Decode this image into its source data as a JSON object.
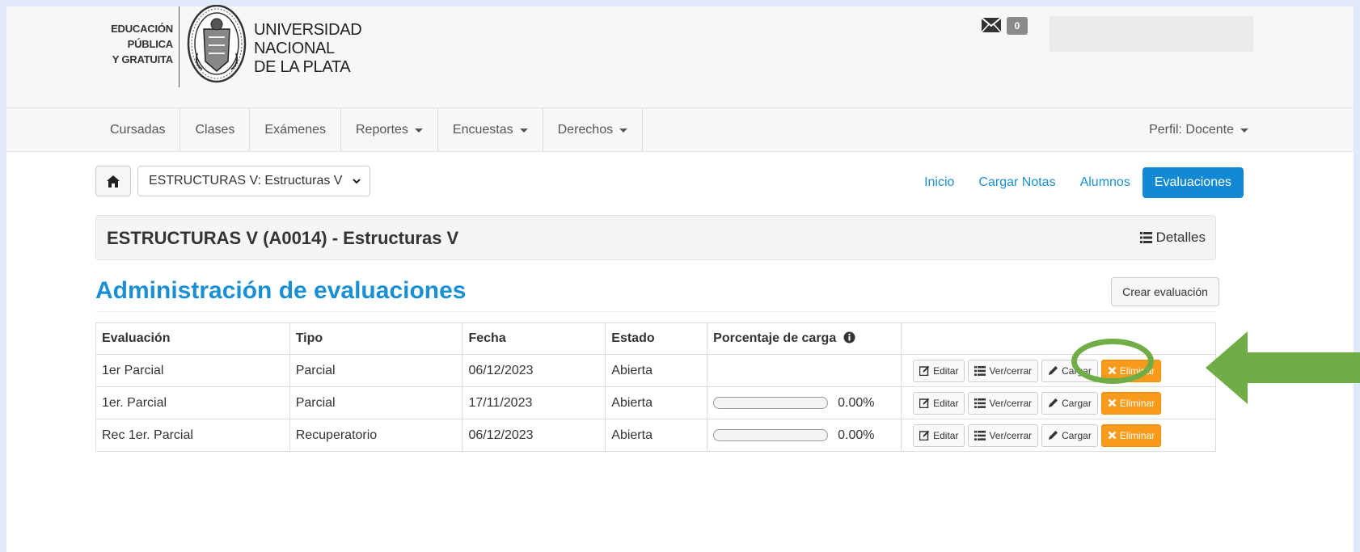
{
  "header": {
    "edu_lines": [
      "EDUCACIÓN",
      "PÚBLICA",
      "Y GRATUITA"
    ],
    "university_lines": [
      "UNIVERSIDAD",
      "NACIONAL",
      "DE LA PLATA"
    ],
    "message_count": "0"
  },
  "nav": {
    "items": [
      {
        "label": "Cursadas",
        "dropdown": false
      },
      {
        "label": "Clases",
        "dropdown": false
      },
      {
        "label": "Exámenes",
        "dropdown": false
      },
      {
        "label": "Reportes",
        "dropdown": true
      },
      {
        "label": "Encuestas",
        "dropdown": true
      },
      {
        "label": "Derechos",
        "dropdown": true
      }
    ],
    "profile": "Perfil: Docente"
  },
  "toolbar": {
    "course_select": "ESTRUCTURAS V: Estructuras V",
    "tabs": [
      {
        "label": "Inicio",
        "active": false
      },
      {
        "label": "Cargar Notas",
        "active": false
      },
      {
        "label": "Alumnos",
        "active": false
      },
      {
        "label": "Evaluaciones",
        "active": true
      }
    ]
  },
  "course": {
    "title": "ESTRUCTURAS V (A0014) - Estructuras V",
    "details_label": "Detalles"
  },
  "page": {
    "title": "Administración de evaluaciones",
    "create_button": "Crear evaluación"
  },
  "table": {
    "headers": [
      "Evaluación",
      "Tipo",
      "Fecha",
      "Estado",
      "Porcentaje de carga"
    ],
    "rows": [
      {
        "evaluacion": "1er Parcial",
        "tipo": "Parcial",
        "fecha": "06/12/2023",
        "estado": "Abierta",
        "percent": null,
        "percent_label": ""
      },
      {
        "evaluacion": "1er. Parcial",
        "tipo": "Parcial",
        "fecha": "17/11/2023",
        "estado": "Abierta",
        "percent": 0,
        "percent_label": "0.00%"
      },
      {
        "evaluacion": "Rec 1er. Parcial",
        "tipo": "Recuperatorio",
        "fecha": "06/12/2023",
        "estado": "Abierta",
        "percent": 0,
        "percent_label": "0.00%"
      }
    ],
    "actions": {
      "edit": "Editar",
      "view": "Ver/cerrar",
      "load": "Cargar",
      "delete": "Eliminar"
    }
  },
  "colors": {
    "accent": "#1489d3",
    "danger": "#f89b1a",
    "annotation": "#70ad47"
  }
}
